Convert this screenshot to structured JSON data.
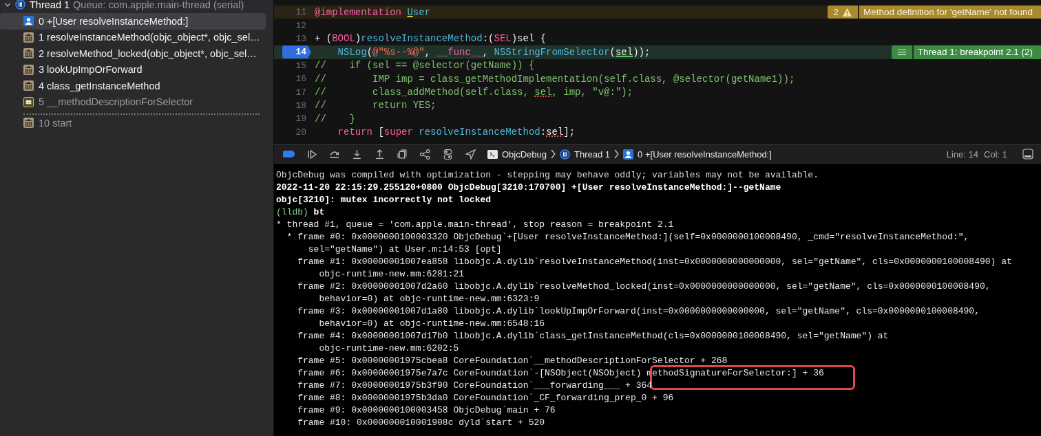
{
  "navigator": {
    "thread": {
      "name": "Thread 1",
      "queue": "Queue: com.apple.main-thread (serial)",
      "expanded": true
    },
    "frames": [
      {
        "label": "0 +[User resolveInstanceMethod:]",
        "kind": "user",
        "selected": true,
        "dimmed": false,
        "gap_before": false
      },
      {
        "label": "1 resolveInstanceMethod(objc_object*, objc_sel…",
        "kind": "library",
        "selected": false,
        "dimmed": false,
        "gap_before": false
      },
      {
        "label": "2 resolveMethod_locked(objc_object*, objc_sel…",
        "kind": "library",
        "selected": false,
        "dimmed": false,
        "gap_before": false
      },
      {
        "label": "3 lookUpImpOrForward",
        "kind": "library",
        "selected": false,
        "dimmed": false,
        "gap_before": false
      },
      {
        "label": "4 class_getInstanceMethod",
        "kind": "library",
        "selected": false,
        "dimmed": false,
        "gap_before": false
      },
      {
        "label": "5 __methodDescriptionForSelector",
        "kind": "hash",
        "selected": false,
        "dimmed": true,
        "gap_before": false
      },
      {
        "label": "10 start",
        "kind": "library",
        "selected": false,
        "dimmed": true,
        "gap_before": true
      }
    ]
  },
  "editor": {
    "lines": [
      {
        "number": "11",
        "kind": "warning",
        "breakpoint": false,
        "tokens": [
          {
            "text": "@implementation ",
            "kind": "keyword"
          },
          {
            "text": "U",
            "kind": "identifier",
            "underlined": true
          },
          {
            "text": "ser",
            "kind": "identifier"
          }
        ],
        "annotation": {
          "kind": "warning",
          "count": "2",
          "message": "Method definition for 'getName' not found"
        }
      },
      {
        "number": "12",
        "kind": "normal",
        "breakpoint": false
      },
      {
        "number": "13",
        "kind": "normal",
        "breakpoint": false,
        "tokens": [
          {
            "text": "+ (",
            "kind": "plain"
          },
          {
            "text": "BOOL",
            "kind": "keyword"
          },
          {
            "text": ")",
            "kind": "plain"
          },
          {
            "text": "resolveInstanceMethod",
            "kind": "identifier"
          },
          {
            "text": ":(",
            "kind": "plain"
          },
          {
            "text": "SEL",
            "kind": "keyword"
          },
          {
            "text": ")sel {",
            "kind": "plain"
          }
        ]
      },
      {
        "number": "14",
        "kind": "current",
        "breakpoint": true,
        "tokens": [
          {
            "text": "    NSLog",
            "kind": "identifier"
          },
          {
            "text": "(",
            "kind": "plain"
          },
          {
            "text": "@\"%s--%@\"",
            "kind": "string"
          },
          {
            "text": ", ",
            "kind": "plain"
          },
          {
            "text": "__func__",
            "kind": "keyword"
          },
          {
            "text": ", ",
            "kind": "plain"
          },
          {
            "text": "NSStringFromSelector",
            "kind": "identifier"
          },
          {
            "text": "(",
            "kind": "plain"
          },
          {
            "text": "sel",
            "kind": "plain",
            "underlined": true
          },
          {
            "text": "));",
            "kind": "plain"
          }
        ],
        "annotation": {
          "kind": "thread",
          "message": "Thread 1: breakpoint 2.1 (2)"
        }
      },
      {
        "number": "15",
        "kind": "normal",
        "breakpoint": false,
        "tokens": [
          {
            "text": "//    if (sel == @selector(getName)) {",
            "kind": "comment"
          }
        ]
      },
      {
        "number": "16",
        "kind": "normal",
        "breakpoint": false,
        "tokens": [
          {
            "text": "//        IMP imp = class_getMethodImplementation(self.class, @selector(getName1));",
            "kind": "comment"
          }
        ]
      },
      {
        "number": "17",
        "kind": "normal",
        "breakpoint": false,
        "tokens": [
          {
            "text": "//        class_addMethod(self.class, ",
            "kind": "comment"
          },
          {
            "text": "sel",
            "kind": "comment",
            "underlined": true
          },
          {
            "text": ", imp, \"v@:\");",
            "kind": "comment"
          }
        ]
      },
      {
        "number": "18",
        "kind": "normal",
        "breakpoint": false,
        "tokens": [
          {
            "text": "//        return YES;",
            "kind": "comment"
          }
        ]
      },
      {
        "number": "19",
        "kind": "normal",
        "breakpoint": false,
        "tokens": [
          {
            "text": "//    }",
            "kind": "comment"
          }
        ]
      },
      {
        "number": "20",
        "kind": "normal",
        "breakpoint": false,
        "tokens": [
          {
            "text": "    return",
            "kind": "keyword"
          },
          {
            "text": " [",
            "kind": "plain"
          },
          {
            "text": "super ",
            "kind": "keyword"
          },
          {
            "text": "resolveInstanceMethod",
            "kind": "identifier"
          },
          {
            "text": ":",
            "kind": "plain"
          },
          {
            "text": "sel",
            "kind": "plain",
            "underlined": true
          },
          {
            "text": "];",
            "kind": "plain"
          }
        ]
      }
    ]
  },
  "debug_bar": {
    "breakpoints_active": true,
    "breadcrumbs": [
      {
        "label": "ObjcDebug",
        "kind": "terminal"
      },
      {
        "label": "Thread 1",
        "kind": "thread"
      },
      {
        "label": "0 +[User resolveInstanceMethod:]",
        "kind": "user"
      }
    ],
    "line": "Line: 14",
    "column": "Col: 1"
  },
  "console": {
    "messages": [
      {
        "kind": "notice",
        "text": "ObjcDebug was compiled with optimization - stepping may behave oddly; variables may not be available."
      },
      {
        "kind": "output",
        "text": "2022-11-20 22:15:29.255120+0800 ObjcDebug[3210:170700] +[User resolveInstanceMethod:]--getName"
      },
      {
        "kind": "output",
        "text": "objc[3210]: mutex incorrectly not locked"
      }
    ],
    "prompt": "(lldb)",
    "command": "bt",
    "backtrace": {
      "header": "* thread #1, queue = 'com.apple.main-thread', stop reason = breakpoint 2.1",
      "frames": [
        {
          "current": true,
          "highlighted": false,
          "text": "* frame #0: 0x0000000100003320 ObjcDebug`+[User resolveInstanceMethod:](self=0x0000000100008490, _cmd=\"resolveInstanceMethod:\",",
          "continuation": "sel=\"getName\") at User.m:14:53 [opt]"
        },
        {
          "current": false,
          "highlighted": false,
          "text": "frame #1: 0x00000001007ea858 libobjc.A.dylib`resolveInstanceMethod(inst=0x0000000000000000, sel=\"getName\", cls=0x0000000100008490) at",
          "continuation": "objc-runtime-new.mm:6281:21"
        },
        {
          "current": false,
          "highlighted": false,
          "text": "frame #2: 0x00000001007d2a60 libobjc.A.dylib`resolveMethod_locked(inst=0x0000000000000000, sel=\"getName\", cls=0x0000000100008490,",
          "continuation": "behavior=0) at objc-runtime-new.mm:6323:9"
        },
        {
          "current": false,
          "highlighted": false,
          "text": "frame #3: 0x00000001007d1a80 libobjc.A.dylib`lookUpImpOrForward(inst=0x0000000000000000, sel=\"getName\", cls=0x0000000100008490,",
          "continuation": "behavior=0) at objc-runtime-new.mm:6548:16"
        },
        {
          "current": false,
          "highlighted": false,
          "text": "frame #4: 0x00000001007d17b0 libobjc.A.dylib`class_getInstanceMethod(cls=0x0000000100008490, sel=\"getName\") at",
          "continuation": "objc-runtime-new.mm:6202:5"
        },
        {
          "current": false,
          "highlighted": false,
          "text": "frame #5: 0x00000001975cbea8 CoreFoundation`__methodDescriptionForSelector + 268"
        },
        {
          "current": false,
          "highlighted": true,
          "text": "frame #6: 0x00000001975e7a7c CoreFoundation`-[NSObject(NSObject) methodSignatureForSelector:] + 36"
        },
        {
          "current": false,
          "highlighted": false,
          "text": "frame #7: 0x00000001975b3f90 CoreFoundation`___forwarding___ + 364"
        },
        {
          "current": false,
          "highlighted": false,
          "text": "frame #8: 0x00000001975b3da0 CoreFoundation`_CF_forwarding_prep_0 + 96"
        },
        {
          "current": false,
          "highlighted": false,
          "text": "frame #9: 0x0000000100003458 ObjcDebug`main + 76"
        },
        {
          "current": false,
          "highlighted": false,
          "text": "frame #10: 0x000000010001908c dyld`start + 520"
        }
      ]
    }
  }
}
